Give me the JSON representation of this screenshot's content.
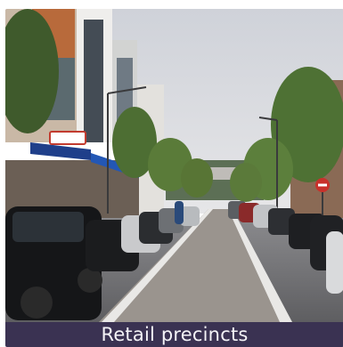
{
  "photo": {
    "subject": "street-scene-photo",
    "colors": {
      "sky": "#d9dbe0",
      "road": "#6f6f72",
      "median": "#8f8a86",
      "caption_background": "#3a3252",
      "caption_text": "#f4f3f7"
    },
    "storefront_sign": "",
    "road_sign_icon": "no-entry-sign-icon"
  },
  "caption": {
    "text": "Retail precincts"
  }
}
